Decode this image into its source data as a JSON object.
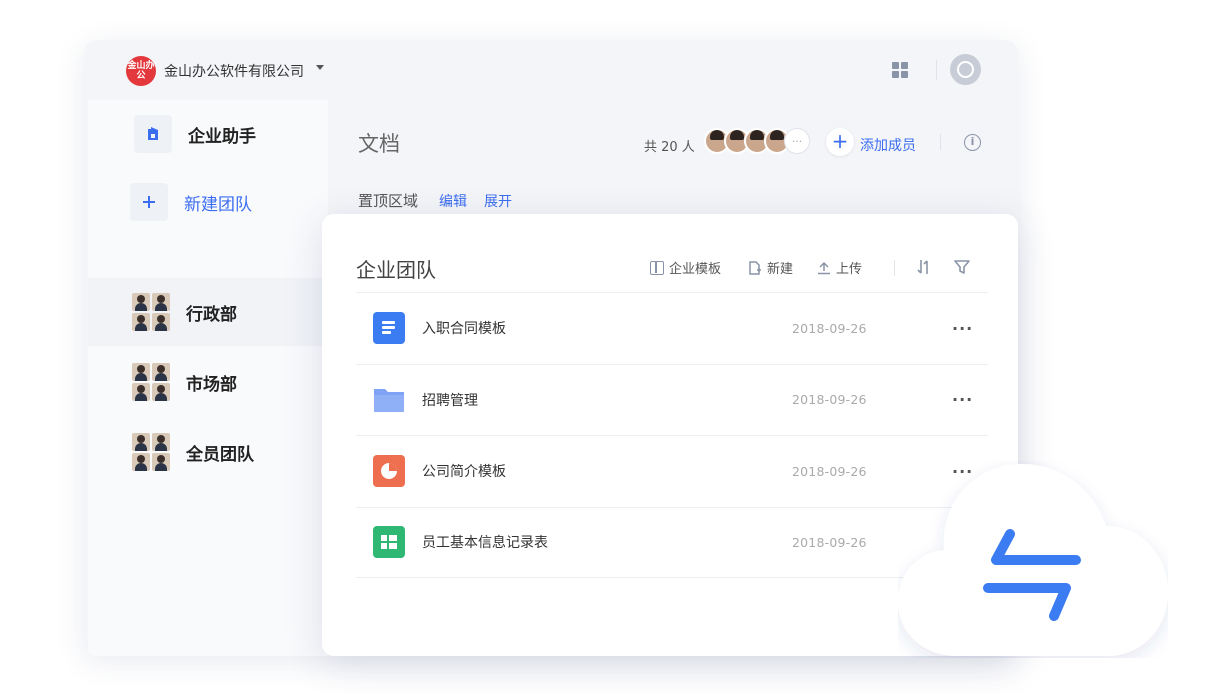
{
  "topbar": {
    "logo_text": "金山办公",
    "company_name": "金山办公软件有限公司",
    "icons": [
      "apps-grid-icon",
      "user-avatar-icon"
    ]
  },
  "sidebar": {
    "items": [
      {
        "label": "企业助手",
        "icon": "assistant-icon"
      },
      {
        "label": "新建团队",
        "icon": "plus-icon"
      },
      {
        "label": "行政部",
        "icon": "team-avatars"
      },
      {
        "label": "市场部",
        "icon": "team-avatars"
      },
      {
        "label": "全员团队",
        "icon": "team-avatars"
      }
    ]
  },
  "main": {
    "title": "文档",
    "member_count": "共 20 人",
    "add_member": "添加成员",
    "pinned": {
      "label": "置顶区域",
      "edit": "编辑",
      "expand": "展开"
    }
  },
  "card": {
    "title": "企业团队",
    "toolbar": {
      "template": "企业模板",
      "new": "新建",
      "upload": "上传"
    },
    "files": [
      {
        "name": "入职合同模板",
        "date": "2018-09-26",
        "type": "doc"
      },
      {
        "name": "招聘管理",
        "date": "2018-09-26",
        "type": "folder"
      },
      {
        "name": "公司简介模板",
        "date": "2018-09-26",
        "type": "ppt"
      },
      {
        "name": "员工基本信息记录表",
        "date": "2018-09-26",
        "type": "sheet"
      }
    ],
    "more": "···"
  },
  "colors": {
    "accent": "#3b6df0",
    "logo": "#e4393c",
    "doc": "#3b7cf2",
    "folder": "#7fa4f5",
    "ppt": "#ee6f4f",
    "sheet": "#2fb774",
    "sync_arrows": "#3b7cf2"
  }
}
